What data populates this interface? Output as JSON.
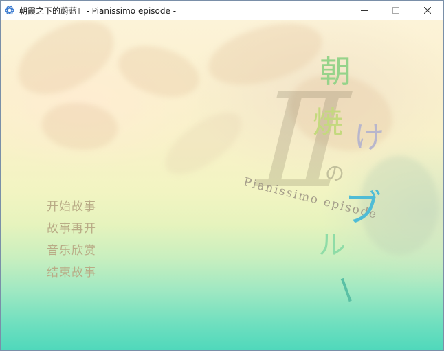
{
  "window": {
    "title": "朝霞之下的蔚蓝Ⅱ  - Pianissimo episode -",
    "icon": "app-icon"
  },
  "logo": {
    "roman_numeral": "Ⅱ",
    "subtitle": "Pianissimo episode",
    "chars": [
      {
        "text": "朝",
        "color": "#96d38a"
      },
      {
        "text": "焼",
        "color": "#c4d97e"
      },
      {
        "text": "け",
        "color": "#b8b6cc"
      },
      {
        "text": "の",
        "color": "#c2c09c"
      },
      {
        "text": "ブ",
        "color": "#4fbcd6"
      },
      {
        "text": "ル",
        "color": "#8fdca7"
      },
      {
        "text": "ー",
        "color": "#5ac0a5"
      }
    ]
  },
  "menu": {
    "items": [
      {
        "label": "开始故事"
      },
      {
        "label": "故事再开"
      },
      {
        "label": "音乐欣赏"
      },
      {
        "label": "结束故事"
      }
    ],
    "color": "#b9ab86"
  }
}
